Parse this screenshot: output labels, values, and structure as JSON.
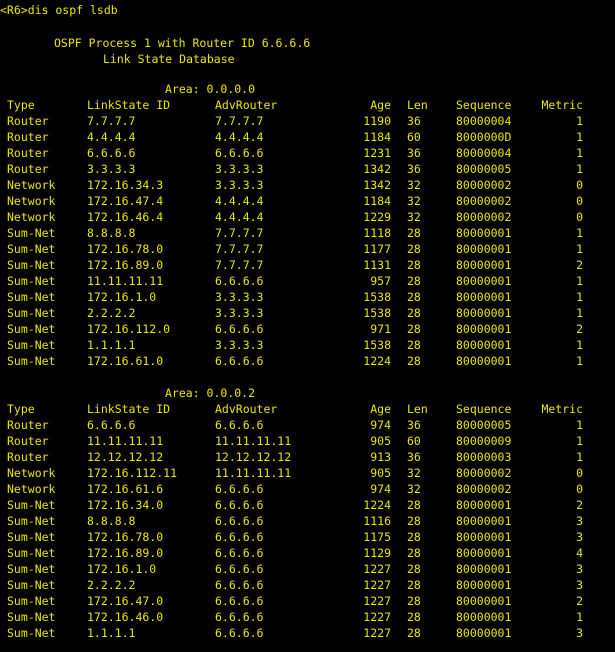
{
  "prompt": "<R6>dis ospf lsdb",
  "process_line": "OSPF Process 1 with Router ID 6.6.6.6",
  "db_title": "Link State Database",
  "header": {
    "type": "Type",
    "lsid": "LinkState ID",
    "adv": "AdvRouter",
    "age": "Age",
    "len": "Len",
    "seq": "Sequence",
    "metric": "Metric"
  },
  "areas": [
    {
      "label": "Area: 0.0.0.0",
      "rows": [
        {
          "type": "Router",
          "lsid": "7.7.7.7",
          "adv": "7.7.7.7",
          "age": "1190",
          "len": "36",
          "seq": "80000004",
          "metric": "1"
        },
        {
          "type": "Router",
          "lsid": "4.4.4.4",
          "adv": "4.4.4.4",
          "age": "1184",
          "len": "60",
          "seq": "8000000D",
          "metric": "1"
        },
        {
          "type": "Router",
          "lsid": "6.6.6.6",
          "adv": "6.6.6.6",
          "age": "1231",
          "len": "36",
          "seq": "80000004",
          "metric": "1"
        },
        {
          "type": "Router",
          "lsid": "3.3.3.3",
          "adv": "3.3.3.3",
          "age": "1342",
          "len": "36",
          "seq": "80000005",
          "metric": "1"
        },
        {
          "type": "Network",
          "lsid": "172.16.34.3",
          "adv": "3.3.3.3",
          "age": "1342",
          "len": "32",
          "seq": "80000002",
          "metric": "0"
        },
        {
          "type": "Network",
          "lsid": "172.16.47.4",
          "adv": "4.4.4.4",
          "age": "1184",
          "len": "32",
          "seq": "80000002",
          "metric": "0"
        },
        {
          "type": "Network",
          "lsid": "172.16.46.4",
          "adv": "4.4.4.4",
          "age": "1229",
          "len": "32",
          "seq": "80000002",
          "metric": "0"
        },
        {
          "type": "Sum-Net",
          "lsid": "8.8.8.8",
          "adv": "7.7.7.7",
          "age": "1118",
          "len": "28",
          "seq": "80000001",
          "metric": "1"
        },
        {
          "type": "Sum-Net",
          "lsid": "172.16.78.0",
          "adv": "7.7.7.7",
          "age": "1177",
          "len": "28",
          "seq": "80000001",
          "metric": "1"
        },
        {
          "type": "Sum-Net",
          "lsid": "172.16.89.0",
          "adv": "7.7.7.7",
          "age": "1131",
          "len": "28",
          "seq": "80000001",
          "metric": "2"
        },
        {
          "type": "Sum-Net",
          "lsid": "11.11.11.11",
          "adv": "6.6.6.6",
          "age": "957",
          "len": "28",
          "seq": "80000001",
          "metric": "1"
        },
        {
          "type": "Sum-Net",
          "lsid": "172.16.1.0",
          "adv": "3.3.3.3",
          "age": "1538",
          "len": "28",
          "seq": "80000001",
          "metric": "1"
        },
        {
          "type": "Sum-Net",
          "lsid": "2.2.2.2",
          "adv": "3.3.3.3",
          "age": "1538",
          "len": "28",
          "seq": "80000001",
          "metric": "1"
        },
        {
          "type": "Sum-Net",
          "lsid": "172.16.112.0",
          "adv": "6.6.6.6",
          "age": "971",
          "len": "28",
          "seq": "80000001",
          "metric": "2"
        },
        {
          "type": "Sum-Net",
          "lsid": "1.1.1.1",
          "adv": "3.3.3.3",
          "age": "1538",
          "len": "28",
          "seq": "80000001",
          "metric": "1"
        },
        {
          "type": "Sum-Net",
          "lsid": "172.16.61.0",
          "adv": "6.6.6.6",
          "age": "1224",
          "len": "28",
          "seq": "80000001",
          "metric": "1"
        }
      ]
    },
    {
      "label": "Area: 0.0.0.2",
      "rows": [
        {
          "type": "Router",
          "lsid": "6.6.6.6",
          "adv": "6.6.6.6",
          "age": "974",
          "len": "36",
          "seq": "80000005",
          "metric": "1"
        },
        {
          "type": "Router",
          "lsid": "11.11.11.11",
          "adv": "11.11.11.11",
          "age": "905",
          "len": "60",
          "seq": "80000009",
          "metric": "1"
        },
        {
          "type": "Router",
          "lsid": "12.12.12.12",
          "adv": "12.12.12.12",
          "age": "913",
          "len": "36",
          "seq": "80000003",
          "metric": "1"
        },
        {
          "type": "Network",
          "lsid": "172.16.112.11",
          "adv": "11.11.11.11",
          "age": "905",
          "len": "32",
          "seq": "80000002",
          "metric": "0"
        },
        {
          "type": "Network",
          "lsid": "172.16.61.6",
          "adv": "6.6.6.6",
          "age": "974",
          "len": "32",
          "seq": "80000002",
          "metric": "0"
        },
        {
          "type": "Sum-Net",
          "lsid": "172.16.34.0",
          "adv": "6.6.6.6",
          "age": "1224",
          "len": "28",
          "seq": "80000001",
          "metric": "2"
        },
        {
          "type": "Sum-Net",
          "lsid": "8.8.8.8",
          "adv": "6.6.6.6",
          "age": "1116",
          "len": "28",
          "seq": "80000001",
          "metric": "3"
        },
        {
          "type": "Sum-Net",
          "lsid": "172.16.78.0",
          "adv": "6.6.6.6",
          "age": "1175",
          "len": "28",
          "seq": "80000001",
          "metric": "3"
        },
        {
          "type": "Sum-Net",
          "lsid": "172.16.89.0",
          "adv": "6.6.6.6",
          "age": "1129",
          "len": "28",
          "seq": "80000001",
          "metric": "4"
        },
        {
          "type": "Sum-Net",
          "lsid": "172.16.1.0",
          "adv": "6.6.6.6",
          "age": "1227",
          "len": "28",
          "seq": "80000001",
          "metric": "3"
        },
        {
          "type": "Sum-Net",
          "lsid": "2.2.2.2",
          "adv": "6.6.6.6",
          "age": "1227",
          "len": "28",
          "seq": "80000001",
          "metric": "3"
        },
        {
          "type": "Sum-Net",
          "lsid": "172.16.47.0",
          "adv": "6.6.6.6",
          "age": "1227",
          "len": "28",
          "seq": "80000001",
          "metric": "2"
        },
        {
          "type": "Sum-Net",
          "lsid": "172.16.46.0",
          "adv": "6.6.6.6",
          "age": "1227",
          "len": "28",
          "seq": "80000001",
          "metric": "1"
        },
        {
          "type": "Sum-Net",
          "lsid": "1.1.1.1",
          "adv": "6.6.6.6",
          "age": "1227",
          "len": "28",
          "seq": "80000001",
          "metric": "3"
        }
      ]
    }
  ],
  "colors": {
    "background": "#000000",
    "text": "#e8e800"
  }
}
